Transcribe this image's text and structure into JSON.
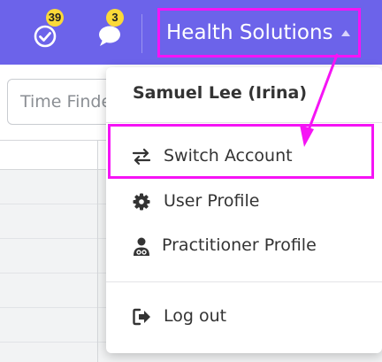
{
  "header": {
    "tasks_badge": "39",
    "messages_badge": "3",
    "account_name": "Health Solutions"
  },
  "search": {
    "placeholder_visible": "Time Finde"
  },
  "menu": {
    "user_name": "Samuel Lee (Irina)",
    "items": [
      {
        "label": "Switch Account",
        "icon": "switch-arrows-icon"
      },
      {
        "label": "User Profile",
        "icon": "gear-icon"
      },
      {
        "label": "Practitioner Profile",
        "icon": "practitioner-icon"
      },
      {
        "label": "Log out",
        "icon": "sign-out-icon"
      }
    ]
  },
  "colors": {
    "topbar": "#6c63ea",
    "annotation": "#f514f5",
    "badge": "#fbd938"
  }
}
